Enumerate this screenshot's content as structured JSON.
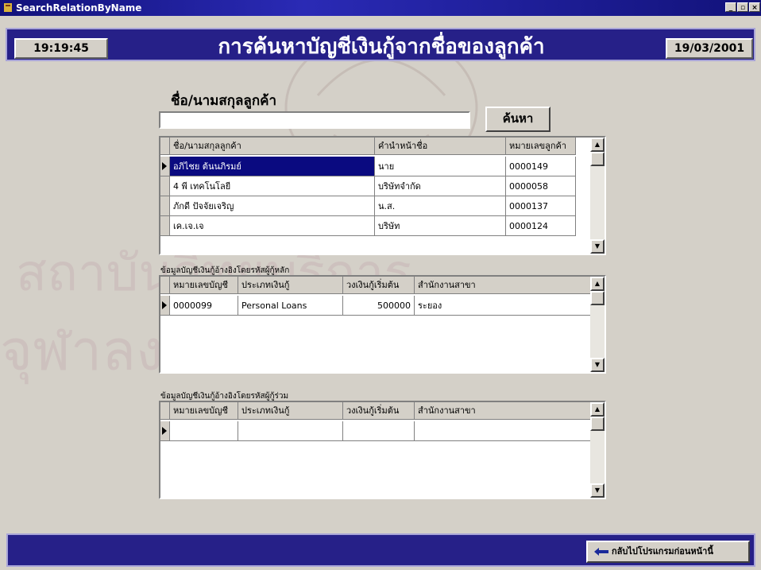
{
  "window": {
    "title": "SearchRelationByName",
    "controls": [
      "minimize-icon",
      "maximize-icon",
      "close-icon"
    ]
  },
  "header": {
    "time": "19:19:45",
    "title": "การค้นหาบัญชีเงินกู้จากชื่อของลูกค้า",
    "date": "19/03/2001"
  },
  "search": {
    "label": "ชื่อ/นามสกุลลูกค้า",
    "value": "",
    "button_label": "ค้นหา"
  },
  "customers": {
    "columns": [
      "ชื่อ/นามสกุลลูกค้า",
      "คำนำหน้าชื่อ",
      "หมายเลขลูกค้า"
    ],
    "rows": [
      [
        "อภิไชย ต้นนภิรมย์",
        "นาย",
        "0000149"
      ],
      [
        "4 พี เทคโนโลยี",
        "บริษัทจำกัด",
        "0000058"
      ],
      [
        "ภักดี ปัจจัยเจริญ",
        "น.ส.",
        "0000137"
      ],
      [
        "เค.เจ.เจ",
        "บริษัท",
        "0000124"
      ]
    ],
    "selected_row": 0
  },
  "main_accounts": {
    "label": "ข้อมูลบัญชีเงินกู้อ้างอิงโดยรหัสผู้กู้หลัก",
    "columns": [
      "หมายเลขบัญชี",
      "ประเภทเงินกู้",
      "วงเงินกู้เริ่มต้น",
      "สำนักงานสาขา"
    ],
    "rows": [
      [
        "0000099",
        "Personal Loans",
        "500000",
        "ระยอง"
      ]
    ]
  },
  "joint_accounts": {
    "label": "ข้อมูลบัญชีเงินกู้อ้างอิงโดยรหัสผู้กู้ร่วม",
    "columns": [
      "หมายเลขบัญชี",
      "ประเภทเงินกู้",
      "วงเงินกู้เริ่มต้น",
      "สำนักงานสาขา"
    ],
    "rows": []
  },
  "footer": {
    "back_label": "กลับไปโปรแกรมก่อนหน้านี้",
    "back_icon": "back-arrow-icon"
  },
  "watermark": {
    "line1": "สถาบันวิทยบริการ",
    "line2": "จุฬาลงกรณ์มหาวิทยาลัย"
  },
  "colors": {
    "header_bg": "#262088",
    "title_text": "#ffffff",
    "selection": "#0a0a80",
    "window_bg": "#d4d0c8"
  }
}
